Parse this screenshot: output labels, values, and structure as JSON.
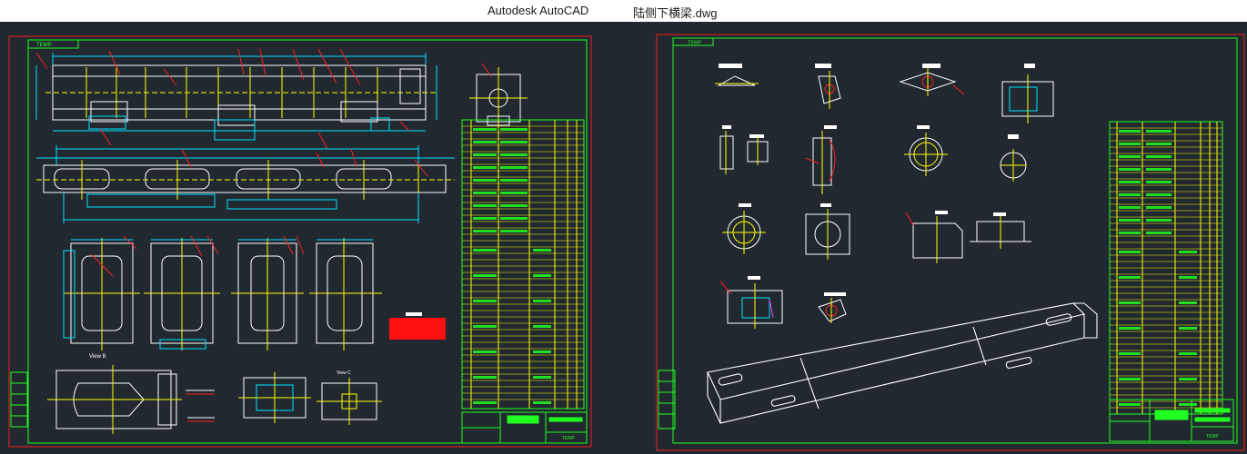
{
  "window": {
    "app_name": "Autodesk AutoCAD",
    "file_name": "陆侧下横梁.dwg"
  },
  "sheets": [
    {
      "tag": "TEMP",
      "title_block_tag": "TEMP"
    },
    {
      "tag": "TEMP",
      "title_block_tag": "TEMP"
    }
  ],
  "labels": {
    "view_b": "View B",
    "view_c": "View C"
  },
  "colors": {
    "background": "#212830",
    "frame_red": "#d02020",
    "frame_green": "#20ff20",
    "drawing_white": "#ffffff",
    "dimension_cyan": "#00e5ff",
    "leader_red": "#ff2020",
    "center_yellow": "#ffff00",
    "weld_magenta": "#ff40ff"
  }
}
